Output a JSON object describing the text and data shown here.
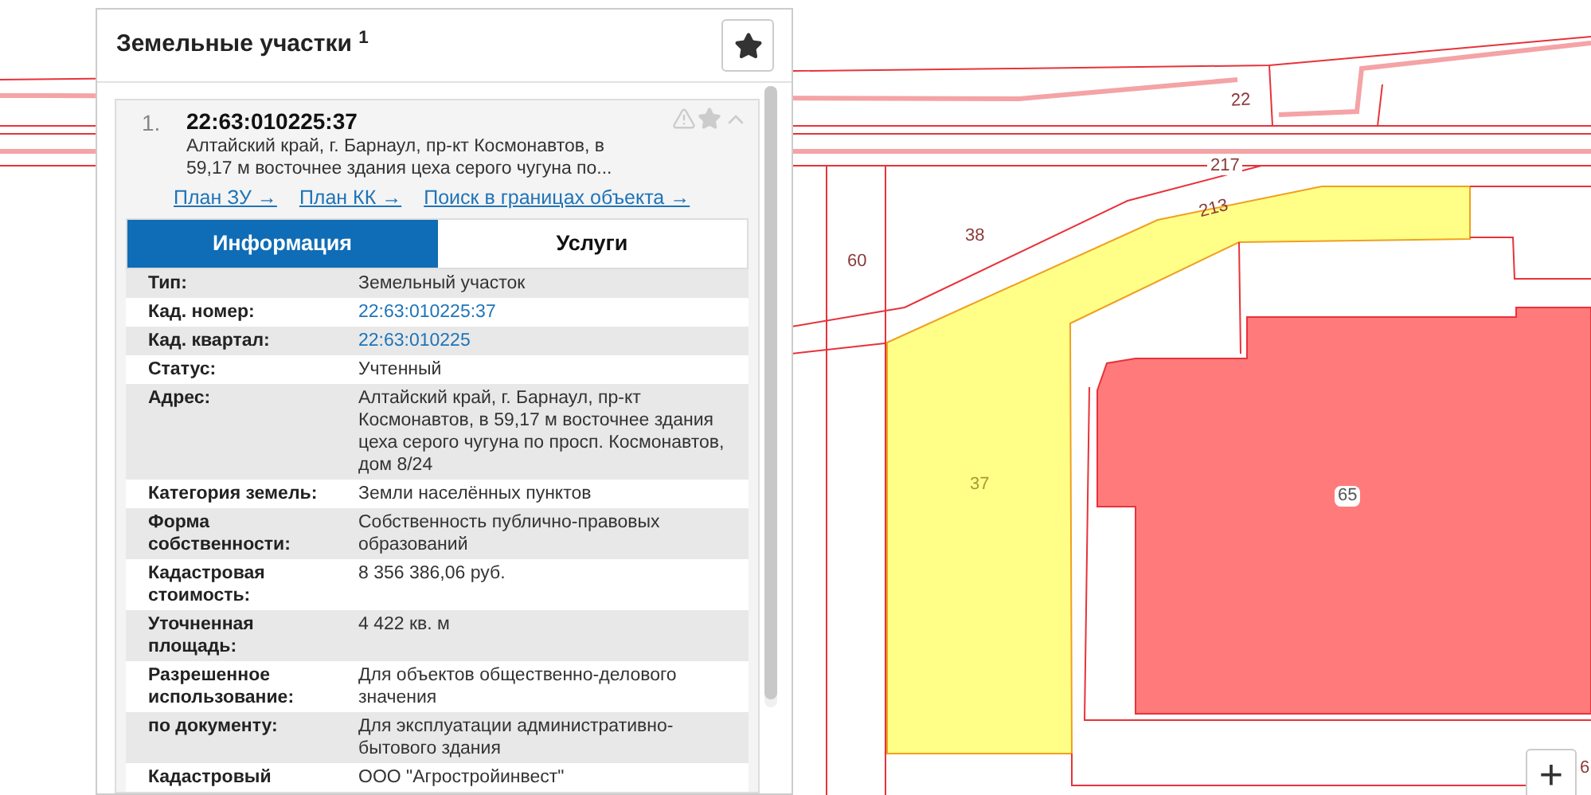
{
  "panel": {
    "title": "Земельные участки $^{1}$"
  },
  "result": {
    "index": "1.",
    "number": "22:63:010225:37",
    "address": "Алтайский край, г. Барнаул, пр-кт Космонавтов, в 59,17 м восточнее здания цеха серого чугуна по...",
    "links": [
      "План ЗУ →",
      "План КК →",
      "Поиск в границах объекта →"
    ],
    "tabs": [
      {
        "label": "Информация",
        "selected": true
      },
      {
        "label": "Услуги",
        "selected": false
      }
    ],
    "rows": [
      {
        "label": "Тип:",
        "value": "Земельный участок",
        "kind": "text"
      },
      {
        "label": "Кад. номер:",
        "value": "22:63:010225:37",
        "kind": "link"
      },
      {
        "label": "Кад. квартал:",
        "value": "22:63:010225",
        "kind": "link"
      },
      {
        "label": "Статус:",
        "value": "Учтенный",
        "kind": "text"
      },
      {
        "label": "Адрес:",
        "value": "Алтайский край, г. Барнаул, пр-кт Космонавтов, в 59,17 м восточнее здания цеха серого чугуна по просп. Космонавтов, дом 8/24",
        "kind": "text"
      },
      {
        "label": "Категория земель:",
        "value": "Земли населённых пунктов",
        "kind": "text"
      },
      {
        "label": "Форма собственности:",
        "value": "Собственность публично-правовых образований",
        "kind": "text"
      },
      {
        "label": "Кадастровая стоимость:",
        "value": "8 356 386,06 руб.",
        "kind": "text"
      },
      {
        "label": "Уточненная площадь:",
        "value": "4 422 кв. м",
        "kind": "text"
      },
      {
        "label": "Разрешенное использование:",
        "value": "Для объектов общественно-делового значения",
        "kind": "text"
      },
      {
        "label": "по документу:",
        "value": "Для эксплуатации административно-бытового здания",
        "kind": "text"
      },
      {
        "label": "Кадастровый",
        "value": "ООО \"Агростройинвест\"",
        "kind": "text"
      }
    ]
  },
  "map": {
    "labels": [
      {
        "text": "22",
        "kind": "plain"
      },
      {
        "text": "217",
        "kind": "road"
      },
      {
        "text": "213",
        "kind": "plain"
      },
      {
        "text": "38",
        "kind": "plain"
      },
      {
        "text": "60",
        "kind": "plain"
      },
      {
        "text": "37",
        "kind": "selected"
      },
      {
        "text": "65",
        "kind": "badge"
      },
      {
        "text": "6",
        "kind": "plain"
      }
    ],
    "zoom_in": "+"
  }
}
